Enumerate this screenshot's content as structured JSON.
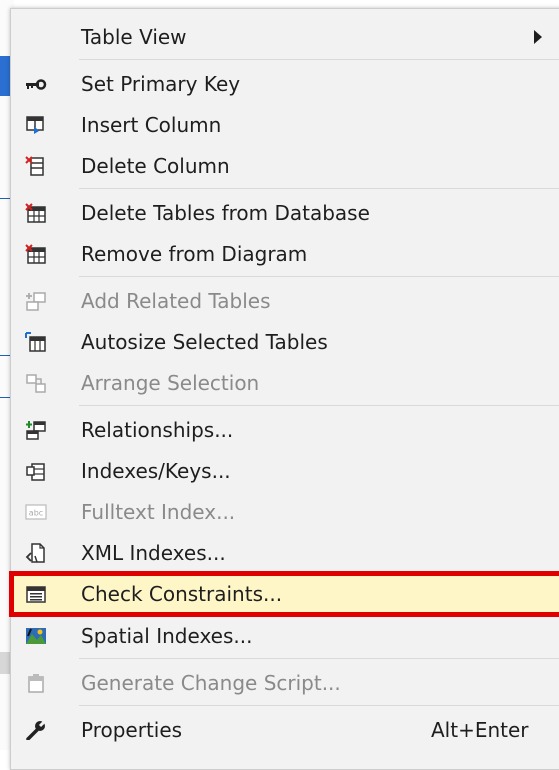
{
  "menu": {
    "items": [
      {
        "id": "table-view",
        "label": "Table View",
        "icon": "none",
        "submenu": true,
        "disabled": false
      },
      {
        "id": "set-primary-key",
        "label": "Set Primary Key",
        "icon": "key-icon",
        "disabled": false
      },
      {
        "id": "insert-column",
        "label": "Insert Column",
        "icon": "insert-column-icon",
        "disabled": false
      },
      {
        "id": "delete-column",
        "label": "Delete Column",
        "icon": "delete-column-icon",
        "disabled": false
      },
      {
        "id": "delete-tables",
        "label": "Delete Tables from Database",
        "icon": "delete-table-icon",
        "disabled": false
      },
      {
        "id": "remove-from-diagram",
        "label": "Remove from Diagram",
        "icon": "remove-table-icon",
        "disabled": false
      },
      {
        "id": "add-related-tables",
        "label": "Add Related Tables",
        "icon": "related-tables-icon",
        "disabled": true
      },
      {
        "id": "autosize-tables",
        "label": "Autosize Selected Tables",
        "icon": "autosize-icon",
        "disabled": false
      },
      {
        "id": "arrange-selection",
        "label": "Arrange Selection",
        "icon": "arrange-icon",
        "disabled": true
      },
      {
        "id": "relationships",
        "label": "Relationships...",
        "icon": "relationship-icon",
        "disabled": false
      },
      {
        "id": "indexes-keys",
        "label": "Indexes/Keys...",
        "icon": "index-icon",
        "disabled": false
      },
      {
        "id": "fulltext-index",
        "label": "Fulltext Index...",
        "icon": "fulltext-icon",
        "disabled": true
      },
      {
        "id": "xml-indexes",
        "label": "XML Indexes...",
        "icon": "xml-index-icon",
        "disabled": false
      },
      {
        "id": "check-constraints",
        "label": "Check Constraints...",
        "icon": "check-constraint-icon",
        "disabled": false,
        "highlighted": true
      },
      {
        "id": "spatial-indexes",
        "label": "Spatial Indexes...",
        "icon": "spatial-index-icon",
        "disabled": false
      },
      {
        "id": "generate-change-script",
        "label": "Generate Change Script...",
        "icon": "script-icon",
        "disabled": true
      },
      {
        "id": "properties",
        "label": "Properties",
        "icon": "wrench-icon",
        "shortcut": "Alt+Enter",
        "disabled": false
      }
    ]
  },
  "colors": {
    "menu_bg": "#f2f2f2",
    "highlight_border": "#e00000",
    "highlight_fill": "#fff6c8",
    "text": "#1e1e1e",
    "disabled_text": "#8a8a8a"
  }
}
